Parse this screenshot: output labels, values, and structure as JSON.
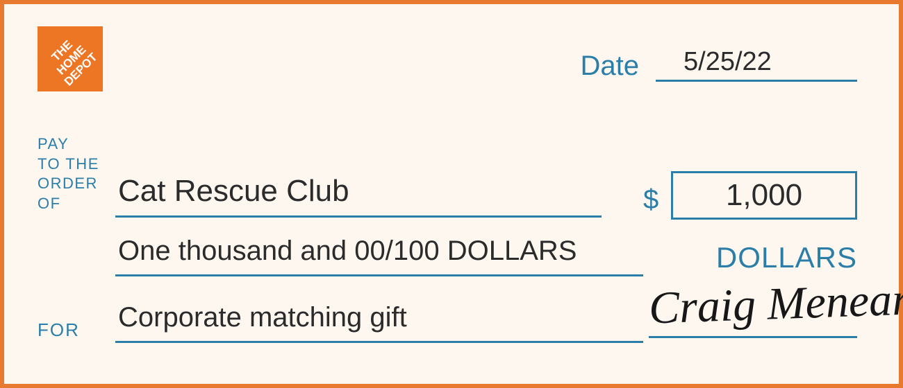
{
  "logo": {
    "name": "THE HOME DEPOT",
    "color": "#ed7625"
  },
  "date": {
    "label": "Date",
    "value": "5/25/22"
  },
  "payto": {
    "label_line1": "PAY",
    "label_line2": "TO THE",
    "label_line3": "ORDER",
    "label_line4": "OF"
  },
  "payee": "Cat Rescue Club",
  "amount": {
    "symbol": "$",
    "numeric": "1,000",
    "words": "One thousand and 00/100 DOLLARS",
    "label": "DOLLARS"
  },
  "memo": {
    "label": "FOR",
    "value": "Corporate matching gift"
  },
  "signature": "Craig Menear"
}
